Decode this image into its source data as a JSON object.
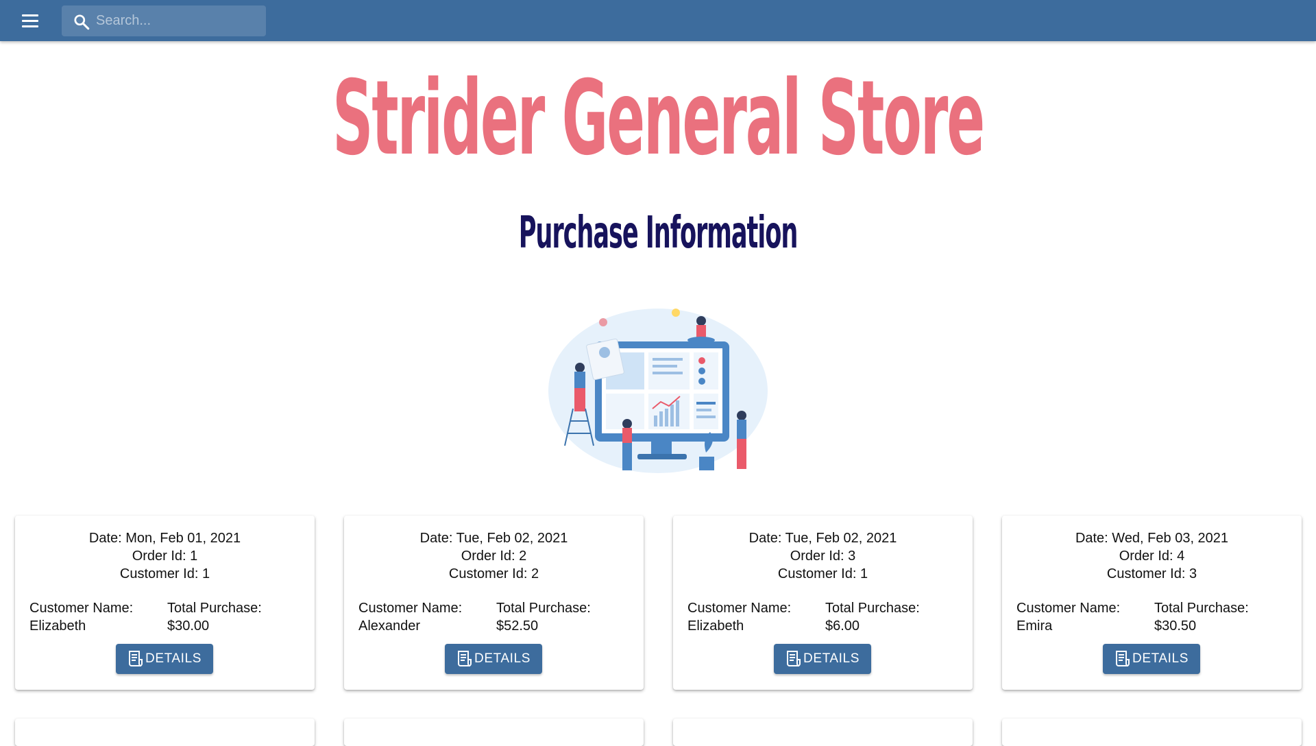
{
  "appbar": {
    "search_placeholder": "Search..."
  },
  "page": {
    "title": "Strider General Store",
    "subtitle": "Purchase Information"
  },
  "colors": {
    "appbar": "#3d6c9d",
    "title": "#ea717e",
    "subtitle": "#17135c",
    "button": "#3d6c9d"
  },
  "cards": [
    {
      "date": "Date: Mon, Feb 01, 2021",
      "order_id": "Order Id: 1",
      "customer_id": "Customer Id: 1",
      "customer_name_label": "Customer Name:",
      "customer_name": "Elizabeth",
      "total_label": "Total Purchase:",
      "total": "$30.00",
      "button_label": "DETAILS"
    },
    {
      "date": "Date: Tue, Feb 02, 2021",
      "order_id": "Order Id: 2",
      "customer_id": "Customer Id: 2",
      "customer_name_label": "Customer Name:",
      "customer_name": "Alexander",
      "total_label": "Total Purchase:",
      "total": "$52.50",
      "button_label": "DETAILS"
    },
    {
      "date": "Date: Tue, Feb 02, 2021",
      "order_id": "Order Id: 3",
      "customer_id": "Customer Id: 1",
      "customer_name_label": "Customer Name:",
      "customer_name": "Elizabeth",
      "total_label": "Total Purchase:",
      "total": "$6.00",
      "button_label": "DETAILS"
    },
    {
      "date": "Date: Wed, Feb 03, 2021",
      "order_id": "Order Id: 4",
      "customer_id": "Customer Id: 3",
      "customer_name_label": "Customer Name:",
      "customer_name": "Emira",
      "total_label": "Total Purchase:",
      "total": "$30.50",
      "button_label": "DETAILS"
    }
  ]
}
